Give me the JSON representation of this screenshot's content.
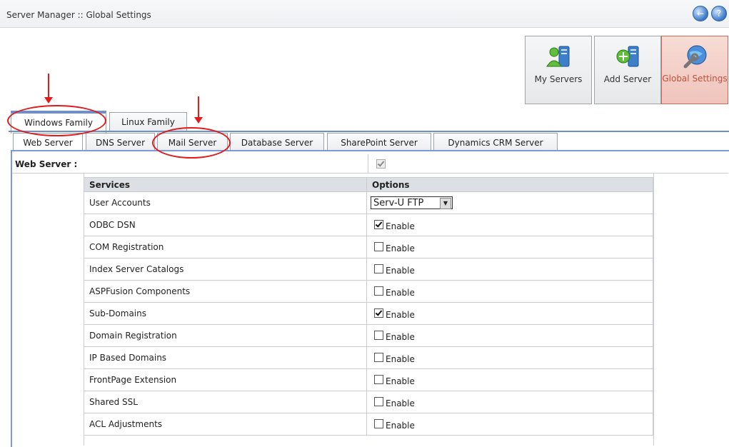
{
  "header": {
    "title": "Server Manager :: Global Settings",
    "back_icon": "arrow-left-icon",
    "help_icon": "help-icon"
  },
  "toolbar": {
    "buttons": [
      {
        "label": "My Servers",
        "icon": "servers-users-icon"
      },
      {
        "label": "Add Server",
        "icon": "add-server-icon"
      },
      {
        "label": "Global Settings",
        "icon": "globe-wrench-icon",
        "active": true
      }
    ]
  },
  "family_tabs": [
    {
      "label": "Windows Family",
      "active": true
    },
    {
      "label": "Linux Family",
      "active": false
    }
  ],
  "server_tabs": [
    {
      "label": "Web Server",
      "active": true
    },
    {
      "label": "DNS Server",
      "active": false
    },
    {
      "label": "Mail Server",
      "active": false
    },
    {
      "label": "Database Server",
      "active": false
    },
    {
      "label": "SharePoint Server",
      "active": false
    },
    {
      "label": "Dynamics CRM Server",
      "active": false
    }
  ],
  "web_server": {
    "label": "Web Server :",
    "checked": true
  },
  "table": {
    "headers": {
      "services": "Services",
      "options": "Options"
    },
    "rows": [
      {
        "service": "User Accounts",
        "type": "select",
        "value": "Serv-U FTP"
      },
      {
        "service": "ODBC DSN",
        "type": "checkbox",
        "checked": true,
        "label": "Enable"
      },
      {
        "service": "COM Registration",
        "type": "checkbox",
        "checked": false,
        "label": "Enable"
      },
      {
        "service": "Index Server Catalogs",
        "type": "checkbox",
        "checked": false,
        "label": "Enable"
      },
      {
        "service": "ASPFusion Components",
        "type": "checkbox",
        "checked": false,
        "label": "Enable"
      },
      {
        "service": "Sub-Domains",
        "type": "checkbox",
        "checked": true,
        "label": "Enable"
      },
      {
        "service": "Domain Registration",
        "type": "checkbox",
        "checked": false,
        "label": "Enable"
      },
      {
        "service": "IP Based Domains",
        "type": "checkbox",
        "checked": false,
        "label": "Enable"
      },
      {
        "service": "FrontPage Extension",
        "type": "checkbox",
        "checked": false,
        "label": "Enable"
      },
      {
        "service": "Shared SSL",
        "type": "checkbox",
        "checked": false,
        "label": "Enable"
      },
      {
        "service": "ACL Adjustments",
        "type": "checkbox",
        "checked": false,
        "label": "Enable"
      }
    ]
  },
  "colors": {
    "accent": "#6b8fd0",
    "annotation": "#e01b1b",
    "active_button": "#efc4bb"
  }
}
